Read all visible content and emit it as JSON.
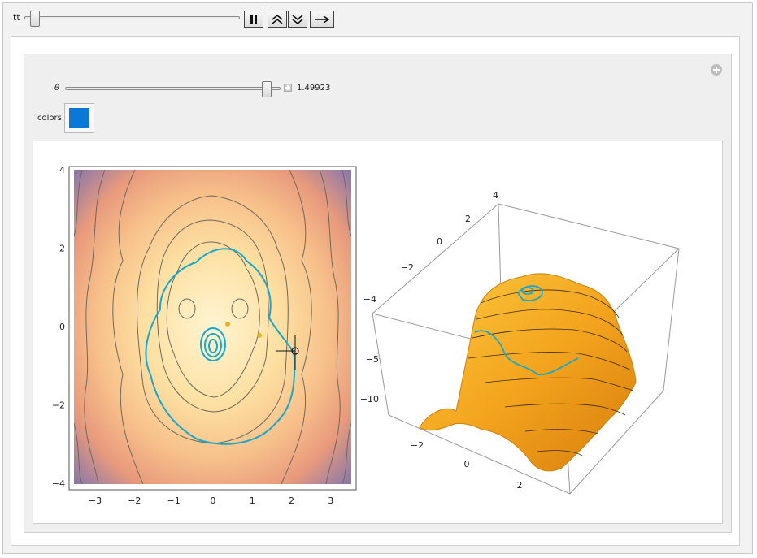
{
  "controls": {
    "tt_label": "tt",
    "theta_label": "θ",
    "theta_value": "1.49923",
    "colors_label": "colors",
    "color_swatch": "#0a78d7"
  },
  "buttons": [
    {
      "name": "pause",
      "icon": "pause-icon"
    },
    {
      "name": "faster",
      "icon": "double-chevron-up-icon"
    },
    {
      "name": "slower",
      "icon": "double-chevron-down-icon"
    },
    {
      "name": "direction",
      "icon": "arrow-right-icon"
    }
  ],
  "slider_values": {
    "tt": 0.0,
    "theta_fraction": 0.95
  },
  "contour_plot": {
    "x_ticks": [
      "−3",
      "−2",
      "−1",
      "0",
      "1",
      "2",
      "3"
    ],
    "y_ticks": [
      "4",
      "2",
      "0",
      "−2",
      "−4"
    ],
    "curve_color": "#1aa7cc"
  },
  "surface_plot": {
    "x_ticks": [
      "−2",
      "0",
      "2"
    ],
    "y_ticks": [
      "−4",
      "−2",
      "0",
      "2",
      "4"
    ],
    "z_ticks": [
      "−5",
      "−10"
    ],
    "surface_color": "#f2a41a"
  }
}
